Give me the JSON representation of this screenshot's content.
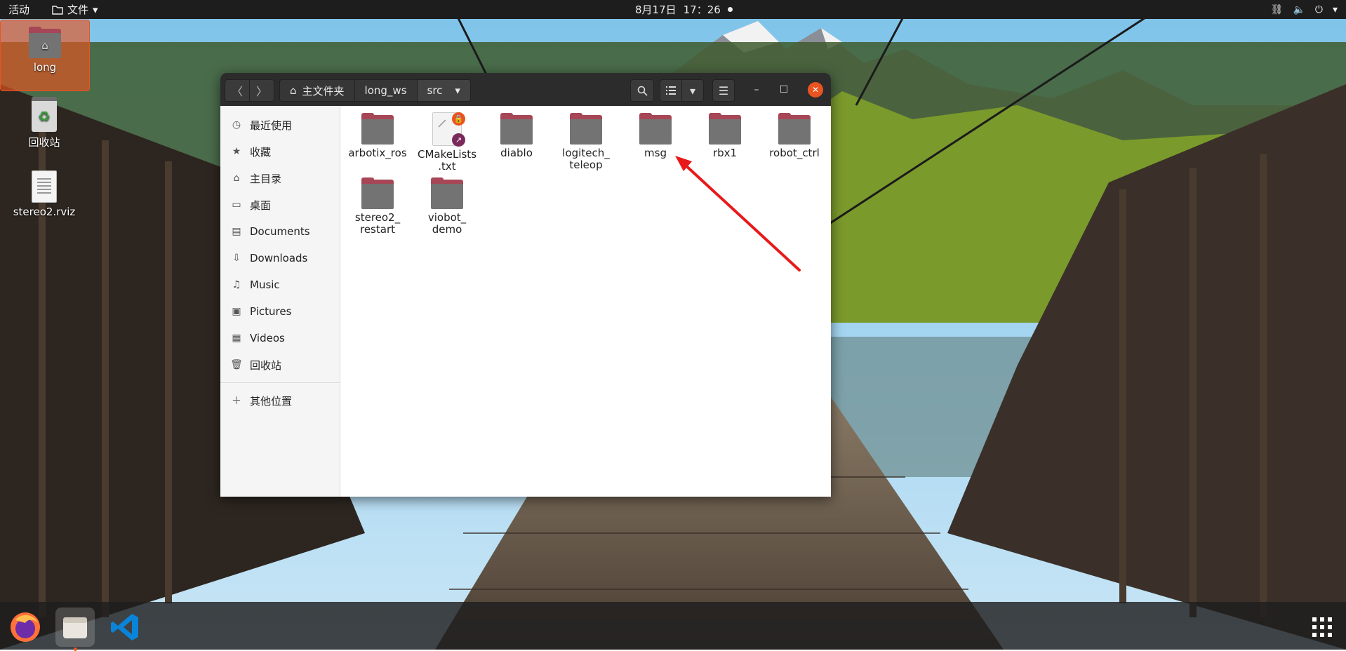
{
  "topbar": {
    "activities": "活动",
    "app_menu": "文件",
    "date": "8月17日",
    "time": "17：26"
  },
  "desktop": {
    "icons": [
      {
        "label": "long"
      },
      {
        "label": "回收站"
      },
      {
        "label": "stereo2.rviz"
      }
    ]
  },
  "window": {
    "breadcrumbs": [
      "主文件夹",
      "long_ws",
      "src"
    ],
    "sidebar": {
      "items": [
        "最近使用",
        "收藏",
        "主目录",
        "桌面",
        "Documents",
        "Downloads",
        "Music",
        "Pictures",
        "Videos",
        "回收站"
      ],
      "other": "其他位置"
    },
    "files": [
      {
        "line1": "arbotix_ros",
        "line2": "",
        "type": "folder"
      },
      {
        "line1": "CMakeLists",
        "line2": ".txt",
        "type": "file"
      },
      {
        "line1": "diablo",
        "line2": "",
        "type": "folder"
      },
      {
        "line1": "logitech_",
        "line2": "teleop",
        "type": "folder"
      },
      {
        "line1": "msg",
        "line2": "",
        "type": "folder"
      },
      {
        "line1": "rbx1",
        "line2": "",
        "type": "folder"
      },
      {
        "line1": "robot_ctrl",
        "line2": "",
        "type": "folder"
      },
      {
        "line1": "stereo2_",
        "line2": "restart",
        "type": "folder"
      },
      {
        "line1": "viobot_",
        "line2": "demo",
        "type": "folder"
      }
    ]
  },
  "dock": {
    "apps": [
      "firefox",
      "files",
      "vscode"
    ]
  },
  "colors": {
    "accent": "#e95420",
    "folder_tab": "#a64656",
    "folder_body": "#737373",
    "annotation_arrow": "#e8191a"
  }
}
